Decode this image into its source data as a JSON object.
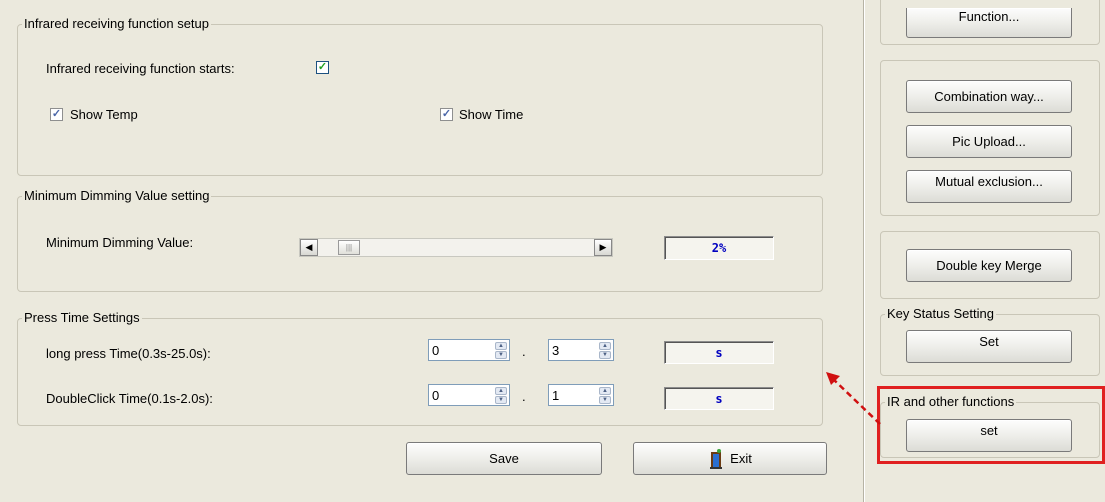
{
  "infrared": {
    "title": "Infrared receiving function setup",
    "starts_label": "Infrared receiving function starts:",
    "starts_checked": true,
    "show_temp_label": "Show Temp",
    "show_temp_checked": true,
    "show_time_label": "Show Time",
    "show_time_checked": true
  },
  "dimming": {
    "title": "Minimum Dimming Value setting",
    "label": "Minimum Dimming Value:",
    "value_display": "2%"
  },
  "press": {
    "title": "Press Time Settings",
    "long_label": "long press Time(0.3s-25.0s):",
    "long_int": "0",
    "long_frac": "3",
    "long_unit": "s",
    "double_label": "DoubleClick Time(0.1s-2.0s):",
    "double_int": "0",
    "double_frac": "1",
    "double_unit": "s",
    "separator": "."
  },
  "actions": {
    "save_label": "Save",
    "exit_label": "Exit"
  },
  "sidebar": {
    "function_label": "Function...",
    "combination_label": "Combination way...",
    "pic_upload_label": "Pic Upload...",
    "mutual_label": "Mutual exclusion...",
    "double_key_label": "Double key Merge",
    "key_status_title": "Key Status Setting",
    "key_status_set_label": "Set",
    "ir_title": "IR and other functions",
    "ir_set_label": "set"
  },
  "colors": {
    "background": "#ebe9dd",
    "highlight_box": "#e02020",
    "arrow": "#d01010",
    "value_text": "#0000c0"
  }
}
